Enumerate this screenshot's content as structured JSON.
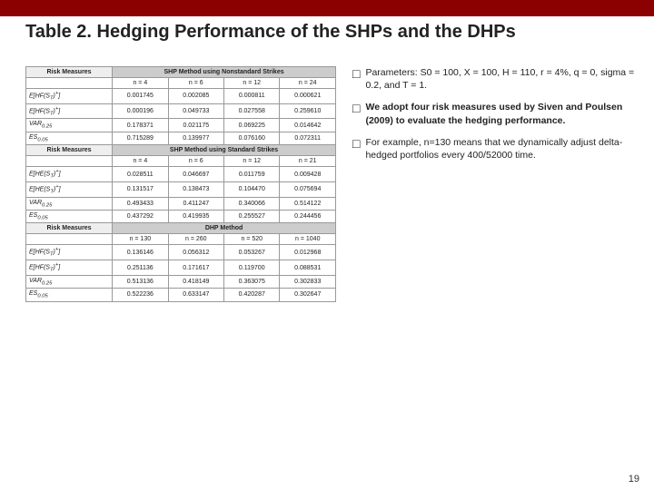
{
  "topbar": {
    "color": "#8b0000"
  },
  "title": "Table 2. Hedging Performance of the SHPs and the DHPs",
  "table": {
    "sections": [
      {
        "header": "SHP Method using Nonstandard Strikes",
        "risk_label": "Risk Measures",
        "columns": [
          "n = 4",
          "n = 6",
          "n = 12",
          "n = 24"
        ],
        "rows": [
          [
            "E[HF(S_T)+]",
            "0.001745",
            "0.002085",
            "0.000811",
            "0.000621"
          ],
          [
            "E[HF(S_T)+]",
            "0.000196",
            "0.049733",
            "0.027558",
            "0.259610"
          ],
          [
            "VAR_0.25",
            "0.178371",
            "0.021175",
            "0.069225",
            "0.014642"
          ],
          [
            "ES_0.05",
            "0.715289",
            "0.139977",
            "0.076160",
            "0.072311"
          ]
        ]
      },
      {
        "header": "SHP Method using Standard Strikes",
        "risk_label": "Risk Measures",
        "columns": [
          "n = 4",
          "n = 6",
          "n = 12",
          "n = 21"
        ],
        "rows": [
          [
            "E[HE(S_T)+]",
            "0.028511",
            "0.046697",
            "0.011759",
            "0.009428"
          ],
          [
            "E[HE(S_T)+]",
            "0.131517",
            "0.138473",
            "0.104470",
            "0.075694"
          ],
          [
            "VAR_0.25",
            "0.493433",
            "0.411247",
            "0.340066",
            "0.514122"
          ],
          [
            "ES_0.05",
            "0.437292",
            "0.419935",
            "0.255527",
            "0.244456"
          ]
        ]
      },
      {
        "header": "DHP Method",
        "risk_label": "Risk Measures",
        "columns": [
          "n = 130",
          "n = 260",
          "n = 520",
          "n = 1040"
        ],
        "rows": [
          [
            "E[HF(S_T)+]",
            "0.136146",
            "0.056312",
            "0.053267",
            "0.012968"
          ],
          [
            "E[HF(S_T)+]",
            "0.251136",
            "0.171617",
            "0.119700",
            "0.088531"
          ],
          [
            "VAR_0.25",
            "0.513136",
            "0.418149",
            "0.363075",
            "0.302833"
          ],
          [
            "ES_0.05",
            "0.522236",
            "0.633147",
            "0.420287",
            "0.302647"
          ]
        ]
      }
    ]
  },
  "bullets": [
    {
      "symbol": "o",
      "text": "Parameters: S0 = 100, X = 100, H = 110, r = 4%, q = 0, sigma = 0.2, and T = 1."
    },
    {
      "symbol": "o",
      "text_parts": [
        {
          "text": "We adopt four risk measures used by Siven and Poulsen (2009) to evaluate the hedging performance.",
          "bold": true
        }
      ]
    },
    {
      "symbol": "o",
      "text": "For example, n=130 means that we dynamically adjust delta-hedged portfolios every 400/52000 time."
    }
  ],
  "page_number": "19"
}
